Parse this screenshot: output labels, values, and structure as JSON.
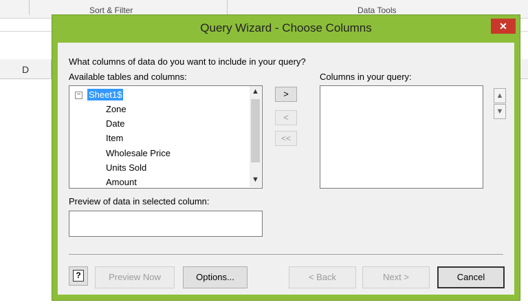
{
  "background": {
    "ribbon_groups": [
      "Sort & Filter",
      "Data Tools"
    ],
    "column_header": "D"
  },
  "dialog": {
    "title": "Query Wizard - Choose Columns",
    "close_glyph": "✕",
    "prompt": "What columns of data do you want to include in your query?",
    "available_label": "Available tables and columns:",
    "query_label": "Columns in your query:",
    "tree": {
      "expander": "−",
      "root": "Sheet1$",
      "children": [
        "Zone",
        "Date",
        "Item",
        "Wholesale Price",
        "Units Sold",
        "Amount"
      ]
    },
    "move_buttons": {
      "add": ">",
      "remove": "<",
      "remove_all": "<<"
    },
    "preview_label": "Preview of data in selected column:",
    "help_glyph": "?",
    "buttons": {
      "preview_now": "Preview Now",
      "options": "Options...",
      "back": "< Back",
      "next": "Next >",
      "cancel": "Cancel"
    }
  },
  "colors": {
    "title_bar": "#8dbe3a",
    "close_button": "#c8392c",
    "selection": "#3399ff",
    "client": "#f0f0f0"
  }
}
